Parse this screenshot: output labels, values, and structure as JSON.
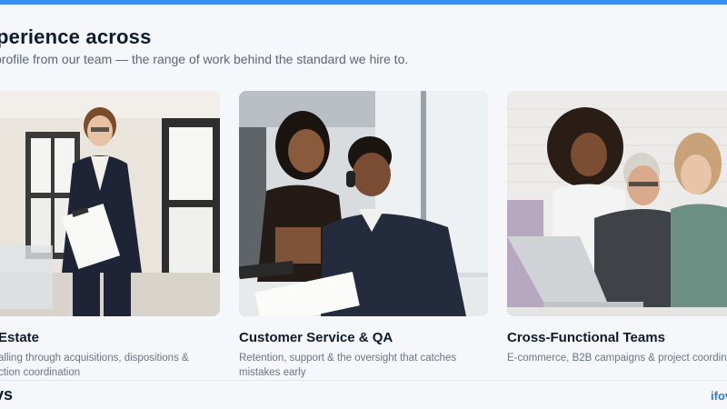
{
  "section": {
    "title": "perience across",
    "subtitle": "profile from our team — the range of work behind the standard we hire to."
  },
  "cards": [
    {
      "title": "Estate",
      "desc_line1": "alling through acquisitions, dispositions &",
      "desc_line2": "ction coordination"
    },
    {
      "title": "Customer Service & QA",
      "desc_line1": "Retention, support & the oversight that catches",
      "desc_line2": "mistakes early"
    },
    {
      "title": "Cross-Functional Teams",
      "desc_line1": "E-commerce, B2B campaigns & project coordina",
      "desc_line2": ""
    }
  ],
  "footer": {
    "left_text": "vs",
    "right_text": "ifov"
  },
  "colors": {
    "accent_bar": "#3b8ff3",
    "link": "#2f7fd1",
    "background": "#f5f7fa"
  }
}
